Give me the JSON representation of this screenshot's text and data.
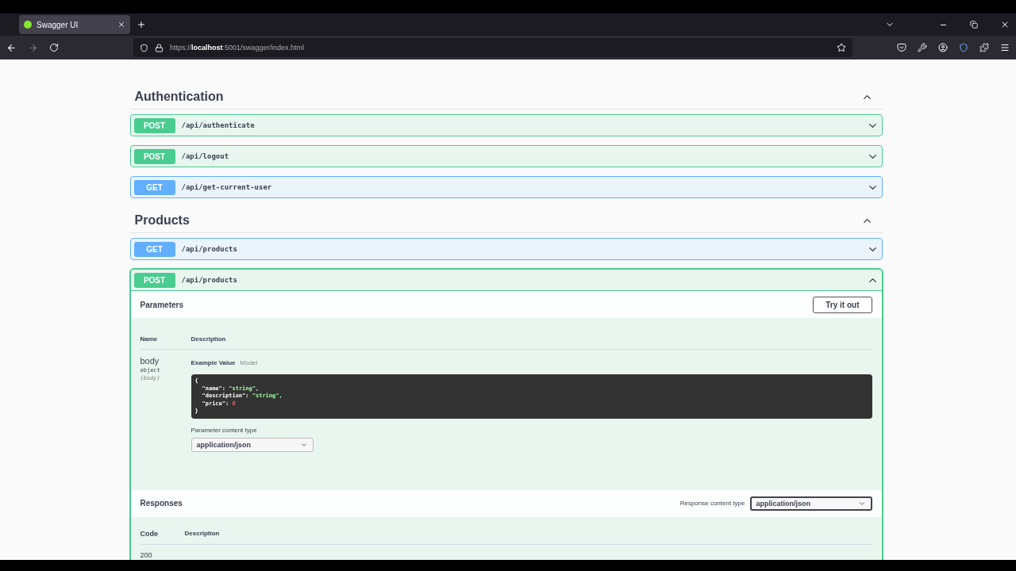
{
  "browser": {
    "tab": {
      "title": "Swagger UI",
      "selected": true
    },
    "url": "https://**localhost**:5001/swagger/index.html"
  },
  "sections": [
    {
      "title": "Authentication",
      "expanded": true,
      "operations": [
        {
          "method": "POST",
          "path": "/api/authenticate",
          "expanded": false
        },
        {
          "method": "POST",
          "path": "/api/logout",
          "expanded": false
        },
        {
          "method": "GET",
          "path": "/api/get-current-user",
          "expanded": false
        }
      ]
    },
    {
      "title": "Products",
      "expanded": true,
      "operations": [
        {
          "method": "GET",
          "path": "/api/products",
          "expanded": false
        },
        {
          "method": "POST",
          "path": "/api/products",
          "expanded": true,
          "details": {
            "parameters_title": "Parameters",
            "try_button": "Try it out",
            "columns": [
              "Name",
              "Description"
            ],
            "params": [
              {
                "name": "body",
                "type": "object",
                "in": "(body)"
              }
            ],
            "example_tabs": [
              {
                "label": "Example Value",
                "selected": true
              },
              {
                "label": "Model",
                "selected": false
              }
            ],
            "code": {
              "open": "{",
              "close": "}",
              "lines": [
                {
                  "key": "\"name\":",
                  "value": "\"string\",",
                  "kind": "string"
                },
                {
                  "key": "\"description\":",
                  "value": "\"string\",",
                  "kind": "string"
                },
                {
                  "key": "\"price\":",
                  "value": "0",
                  "kind": "number"
                }
              ]
            },
            "content_type_label": "Parameter content type",
            "content_type": "application/json",
            "responses_title": "Responses",
            "response_type_label": "Response content type",
            "response_type": "application/json",
            "response_columns": [
              "Code",
              "Description"
            ],
            "response_codes": [
              "200"
            ]
          }
        }
      ]
    }
  ]
}
